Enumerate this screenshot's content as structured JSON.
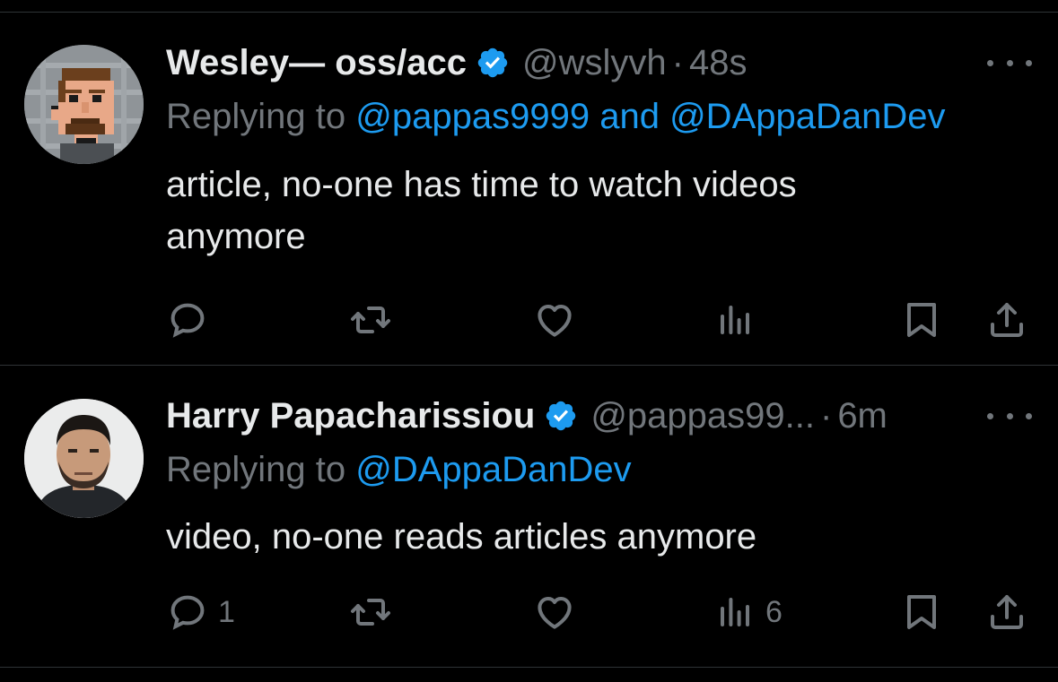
{
  "colors": {
    "background": "#000000",
    "text": "#e7e9ea",
    "muted": "#71767b",
    "accent": "#1d9bf0",
    "divider": "#2f3336"
  },
  "tweets": [
    {
      "display_name": "Wesley— oss/acc",
      "handle": "@wslyvh",
      "separator": "·",
      "time": "48s",
      "reply_prefix": "Replying to",
      "reply_mention_1": "@pappas9999",
      "reply_and": "and",
      "reply_mention_2": "@DAppaDanDev",
      "text_line_1": "article, no-one has time to watch videos",
      "text_line_2": "anymore",
      "reply_count": "",
      "views_count": ""
    },
    {
      "display_name": "Harry Papacharissiou",
      "handle": "@pappas99...",
      "separator": "·",
      "time": "6m",
      "reply_prefix": "Replying to",
      "reply_mention_1": "@DAppaDanDev",
      "text_line_1": "video, no-one reads articles anymore",
      "reply_count": "1",
      "views_count": "6"
    }
  ],
  "icons": {
    "verified": "verified-badge-icon",
    "more": "more-dots-icon",
    "reply": "reply-bubble-icon",
    "retweet": "retweet-icon",
    "like": "heart-icon",
    "views": "views-bars-icon",
    "bookmark": "bookmark-icon",
    "share": "share-icon"
  }
}
